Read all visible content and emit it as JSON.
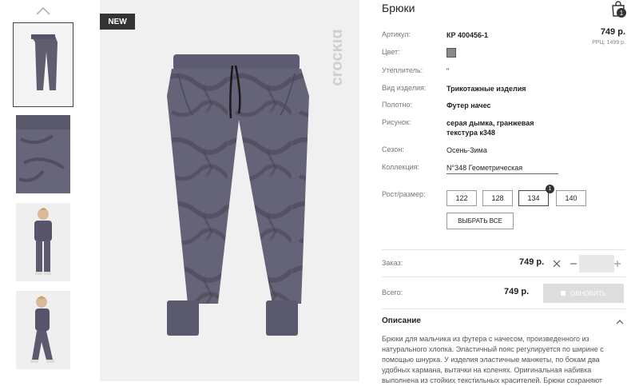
{
  "badge": "NEW",
  "brand": "crockid",
  "product": {
    "title": "Брюки",
    "cart_count": "1",
    "price": "749 р.",
    "rrc": "РРЦ: 1499 р."
  },
  "attrs": [
    {
      "label": "Артикул:",
      "value": "КР 400456-1"
    },
    {
      "label": "Цвет:",
      "value": ""
    },
    {
      "label": "Утеплитель:",
      "value": "\""
    },
    {
      "label": "Вид изделия:",
      "value": "Трикотажные изделия"
    },
    {
      "label": "Полотно:",
      "value": "Футер начес"
    },
    {
      "label": "Рисунок:",
      "value": "серая дымка, гранжевая текстура к348"
    },
    {
      "label": "Сезон:",
      "value": "Осень-Зима"
    },
    {
      "label": "Коллекция:",
      "value": "N°348 Геометрическая"
    }
  ],
  "colors": {
    "swatch": "#8a8a8a",
    "dark": "#333333"
  },
  "sizes": {
    "label": "Рост/размер:",
    "options": [
      "122",
      "128",
      "134",
      "140"
    ],
    "selected": "134",
    "selected_count": "1",
    "select_all": "ВЫБРАТЬ ВСЕ"
  },
  "order": {
    "label": "Заказ:",
    "price": "749 р.",
    "qty": ""
  },
  "total": {
    "label": "Всего:",
    "price": "749 р.",
    "update_btn": "ОБНОВИТЬ"
  },
  "description": {
    "title": "Описание",
    "text": "Брюки для мальчика из футера с начесом, произведенного из натурального хлопка. Эластичный пояс регулируется по ширине с помощью шнурка. У изделия эластичные манжеты, по бокам два удобных кармана, вытачки на коленях. Оригинальная набивка выполнена из стойких текстильных красителей. Брюки сохраняют"
  },
  "icons": {
    "thumb_up": "chevron-up-icon",
    "cart": "shopping-bag-icon",
    "remove": "close-icon",
    "minus": "minus-icon",
    "plus": "plus-icon",
    "desc": "chevron-up-icon"
  }
}
